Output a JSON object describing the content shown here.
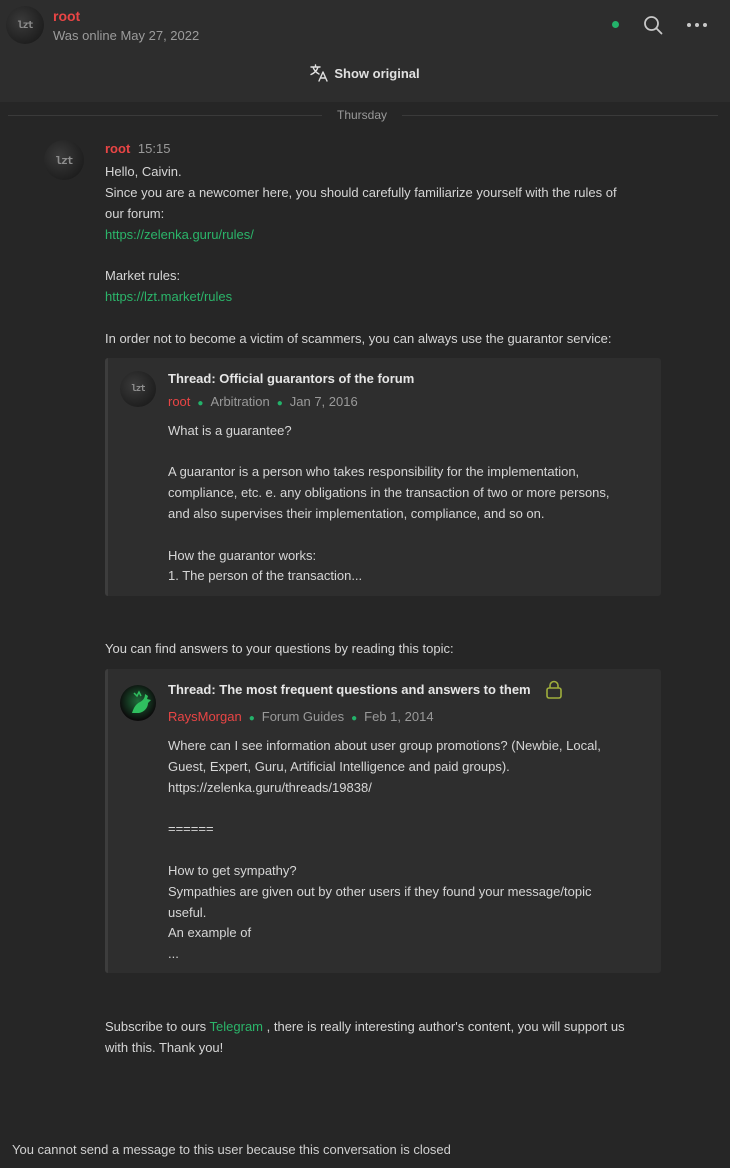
{
  "header": {
    "name": "root",
    "status": "Was online May 27, 2022",
    "avatar_text": "lzt",
    "icons": [
      "online-indicator",
      "search-icon",
      "more-icon"
    ]
  },
  "toolbar": {
    "show_original": "Show original",
    "icon": "translate-icon"
  },
  "day_separator": "Thursday",
  "message": {
    "author": "root",
    "time": "15:15",
    "lines": [
      "Hello, Caivin.",
      "Since you are a newcomer here, you should carefully familiarize yourself with the rules of",
      "our forum:"
    ],
    "rules_link": "https://zelenka.guru/rules/",
    "market_label": "Market rules:",
    "market_link": "https://lzt.market/rules",
    "guarantor_intro": "In order not to become a victim of scammers, you can always use the guarantor service:",
    "quote1": {
      "title": "Thread: Official guarantors of the forum",
      "author": "root",
      "section": "Arbitration",
      "date": "Jan 7, 2016",
      "lines": [
        "What is a guarantee?",
        "A guarantor is a person who takes responsibility for the implementation,",
        "compliance, etc. e. any obligations in the transaction of two or more persons,",
        "and also supervises their implementation, compliance, and so on.",
        "How the guarantor works:",
        "1. The person of the transaction..."
      ]
    },
    "questions_intro": "You can find answers to your questions by reading this topic:",
    "quote2": {
      "title": "Thread: The most frequent questions and answers to them",
      "author": "RaysMorgan",
      "section": "Forum Guides",
      "date": "Feb 1, 2014",
      "lines": [
        "Where can I see information about user group promotions? (Newbie, Local,",
        "Guest, Expert, Guru, Artificial Intelligence and paid groups).",
        "https://zelenka.guru/threads/19838/",
        "======",
        "How to get sympathy?",
        "Sympathies are given out by other users if they found your message/topic",
        "useful.",
        "An example of",
        "..."
      ]
    },
    "subscribe_before": "Subscribe to ours ",
    "subscribe_link": "Telegram",
    "subscribe_after": " , there is really interesting author's content, you will support us",
    "subscribe_line2": "with this. Thank you!"
  },
  "footer": {
    "closed_note": "You cannot send a message to this user because this conversation is closed"
  },
  "colors": {
    "background": "#262626",
    "header": "#2d2d2d",
    "author_red": "#e94545",
    "link_green": "#2bb56a",
    "online_green": "#23b26a"
  }
}
